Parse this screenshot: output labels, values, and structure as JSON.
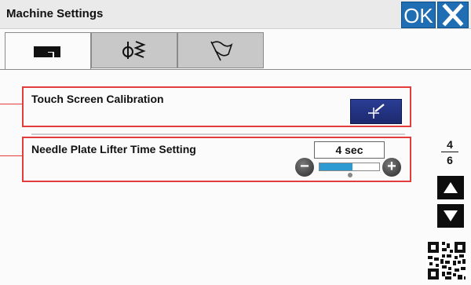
{
  "window": {
    "title": "Machine Settings"
  },
  "header": {
    "ok_label": "OK"
  },
  "tabs": [
    {
      "icon": "sewing-machine-icon",
      "active": true
    },
    {
      "icon": "stitch-icon",
      "active": false
    },
    {
      "icon": "flag-icon",
      "active": false
    }
  ],
  "settings": {
    "calibration": {
      "label": "Touch Screen Calibration"
    },
    "needle_plate": {
      "label": "Needle Plate Lifter Time Setting",
      "value": "4 sec",
      "level_fraction": 0.55
    }
  },
  "pager": {
    "current": "4",
    "total": "6"
  },
  "colors": {
    "accent": "#1f6db3",
    "highlight": "#e23c3c",
    "slider": "#2d9ad2"
  }
}
